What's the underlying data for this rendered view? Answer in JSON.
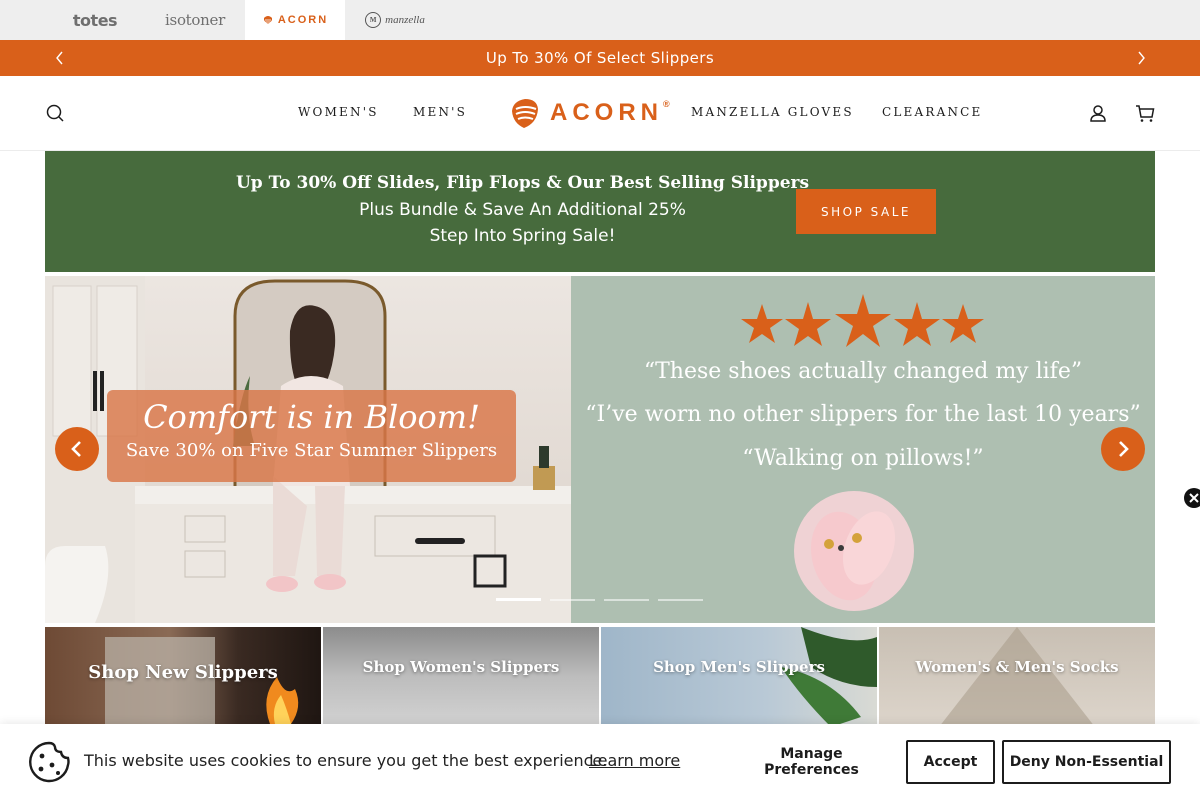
{
  "brand_bar": {
    "brands": [
      {
        "label": "totes",
        "active": false
      },
      {
        "label": "isotoner",
        "active": false
      },
      {
        "label": "ACORN",
        "active": true
      },
      {
        "label": "manzella",
        "active": false
      }
    ]
  },
  "announcement": {
    "text": "Up To 30% Of Select Slippers",
    "prev_icon": "chevron-left-icon",
    "next_icon": "chevron-right-icon"
  },
  "header": {
    "nav": [
      "WOMEN'S",
      "MEN'S",
      "MANZELLA GLOVES",
      "CLEARANCE"
    ],
    "logo_text": "ACORN",
    "logo_mark": "®",
    "icons": [
      "search-icon",
      "account-icon",
      "cart-icon"
    ]
  },
  "promo": {
    "title": "Up To 30% Off Slides, Flip Flops & Our Best Selling Slippers",
    "line1": "Plus Bundle & Save An Additional 25%",
    "line2": "Step Into Spring Sale!",
    "button": "SHOP SALE"
  },
  "hero": {
    "caption_title": "Comfort is in Bloom!",
    "caption_subtitle": "Save 30% on Five Star Summer Slippers",
    "star_count": 5,
    "quotes": [
      "“These shoes actually changed my life”",
      "“I’ve worn no other slippers for the last 10 years”",
      "“Walking on pillows!”"
    ],
    "slide_count": 4,
    "active_slide": 1
  },
  "tiles": [
    {
      "label": "Shop New Slippers"
    },
    {
      "label": "Shop Women's Slippers"
    },
    {
      "label": "Shop Men's Slippers"
    },
    {
      "label": "Women's & Men's Socks"
    }
  ],
  "cookie": {
    "text": "This website uses cookies to ensure you get the best experience.",
    "learn_more": "Learn more",
    "manage": "Manage Preferences",
    "accept": "Accept",
    "deny": "Deny Non-Essential"
  },
  "colors": {
    "accent": "#d9601a",
    "promo_green": "#476b3d",
    "hero_sage": "#aebfb1"
  }
}
